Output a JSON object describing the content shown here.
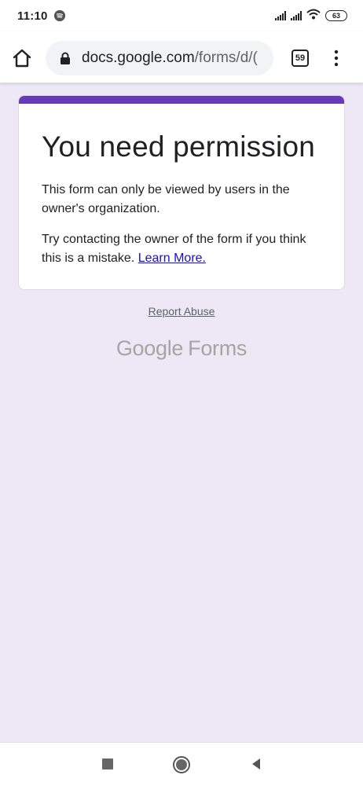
{
  "status_bar": {
    "time": "11:10",
    "battery": "63",
    "icons": [
      "spotify-icon",
      "signal-icon",
      "signal-icon",
      "wifi-icon",
      "battery-icon"
    ]
  },
  "browser": {
    "url_host": "docs.google.com",
    "url_path": "/forms/d/(",
    "tab_count": "59",
    "icons": [
      "home-icon",
      "lock-icon",
      "tabs-icon",
      "more-vert-icon"
    ]
  },
  "card": {
    "accent_color": "#673ab7",
    "title": "You need permission",
    "paragraph1": "This form can only be viewed by users in the owner's organization.",
    "paragraph2": "Try contacting the owner of the form if you think this is a mistake.",
    "learn_more": "Learn More."
  },
  "footer": {
    "report_abuse": "Report Abuse",
    "logo_google": "Google",
    "logo_forms": "Forms"
  },
  "nav": {
    "icons": [
      "recents-icon",
      "home-icon",
      "back-icon"
    ]
  }
}
